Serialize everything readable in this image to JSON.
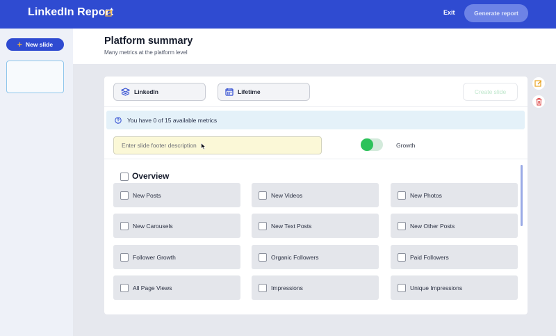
{
  "header": {
    "title": "LinkedIn Report",
    "exit_label": "Exit",
    "generate_label": "Generate report"
  },
  "sidebar": {
    "new_slide_label": "New slide"
  },
  "page": {
    "title": "Platform summary",
    "subtitle": "Many metrics at the platform level"
  },
  "controls": {
    "platform": "LinkedIn",
    "period": "Lifetime",
    "create_label": "Create slide",
    "info_text": "You have 0 of 15 available metrics",
    "footer_placeholder": "Enter slide footer description",
    "footer_value": "",
    "growth_label": "Growth",
    "growth_enabled": true
  },
  "section": {
    "title": "Overview",
    "metrics": [
      {
        "label": "New Posts",
        "checked": false
      },
      {
        "label": "New Videos",
        "checked": false
      },
      {
        "label": "New Photos",
        "checked": false
      },
      {
        "label": "New Carousels",
        "checked": false
      },
      {
        "label": "New Text Posts",
        "checked": false
      },
      {
        "label": "New Other Posts",
        "checked": false
      },
      {
        "label": "Follower Growth",
        "checked": false
      },
      {
        "label": "Organic Followers",
        "checked": false
      },
      {
        "label": "Paid Followers",
        "checked": false
      },
      {
        "label": "All Page Views",
        "checked": false
      },
      {
        "label": "Impressions",
        "checked": false
      },
      {
        "label": "Unique Impressions",
        "checked": false
      }
    ]
  },
  "icons": {
    "edit_title": "edit-icon",
    "platform": "layers-icon",
    "period": "calendar-icon",
    "info": "help-circle-icon",
    "side_edit": "edit-icon",
    "side_delete": "trash-icon"
  },
  "colors": {
    "brand": "#2f4bd1",
    "toggle_on": "#2cc25a",
    "edit_accent": "#e9a321",
    "delete_accent": "#e05757"
  }
}
